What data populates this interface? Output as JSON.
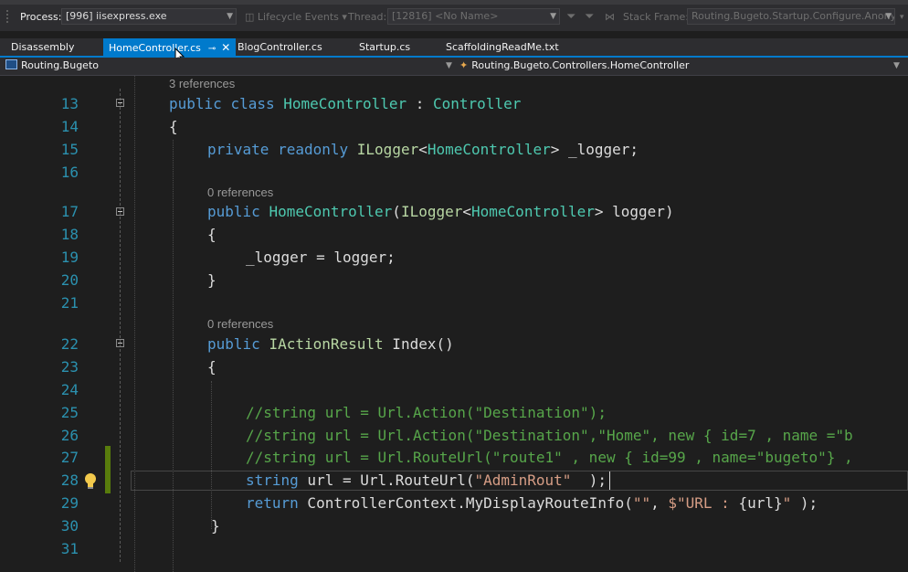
{
  "toolbar": {
    "process_label": "Process:",
    "process_value": "[996] iisexpress.exe",
    "lifecycle_label": "Lifecycle Events",
    "thread_label": "Thread:",
    "thread_value": "[12816] <No Name>",
    "stack_frame_label": "Stack Frame:",
    "stack_frame_value": "Routing.Bugeto.Startup.Configure.Anonyi"
  },
  "tabs": [
    {
      "label": "Disassembly",
      "active": false
    },
    {
      "label": "HomeController.cs",
      "active": true
    },
    {
      "label": "BlogController.cs",
      "active": false
    },
    {
      "label": "Startup.cs",
      "active": false
    },
    {
      "label": "ScaffoldingReadMe.txt",
      "active": false
    }
  ],
  "navbar": {
    "project": "Routing.Bugeto",
    "type": "Routing.Bugeto.Controllers.HomeController"
  },
  "code": {
    "lens_class": "3 references",
    "lens_ctor": "0 references",
    "lens_index": "0 references",
    "lines": [
      {
        "num": "13",
        "tokens": [
          [
            "kw",
            "public"
          ],
          [
            "pl",
            " "
          ],
          [
            "kw",
            "class"
          ],
          [
            "pl",
            " "
          ],
          [
            "ty",
            "HomeController"
          ],
          [
            "pl",
            " : "
          ],
          [
            "ty",
            "Controller"
          ]
        ]
      },
      {
        "num": "14",
        "tokens": [
          [
            "pl",
            "{"
          ]
        ]
      },
      {
        "num": "15",
        "tokens": [
          [
            "kw",
            "private"
          ],
          [
            "pl",
            " "
          ],
          [
            "kw",
            "readonly"
          ],
          [
            "pl",
            " "
          ],
          [
            "in",
            "ILogger"
          ],
          [
            "pl",
            "<"
          ],
          [
            "ty",
            "HomeController"
          ],
          [
            "pl",
            "> _logger;"
          ]
        ]
      },
      {
        "num": "16",
        "tokens": []
      },
      {
        "num": "17",
        "tokens": [
          [
            "kw",
            "public"
          ],
          [
            "pl",
            " "
          ],
          [
            "ty",
            "HomeController"
          ],
          [
            "pl",
            "("
          ],
          [
            "in",
            "ILogger"
          ],
          [
            "pl",
            "<"
          ],
          [
            "ty",
            "HomeController"
          ],
          [
            "pl",
            "> logger)"
          ]
        ]
      },
      {
        "num": "18",
        "tokens": [
          [
            "pl",
            "{"
          ]
        ]
      },
      {
        "num": "19",
        "tokens": [
          [
            "pl",
            "_logger = logger;"
          ]
        ]
      },
      {
        "num": "20",
        "tokens": [
          [
            "pl",
            "}"
          ]
        ]
      },
      {
        "num": "21",
        "tokens": []
      },
      {
        "num": "22",
        "tokens": [
          [
            "kw",
            "public"
          ],
          [
            "pl",
            " "
          ],
          [
            "in",
            "IActionResult"
          ],
          [
            "pl",
            " Index()"
          ]
        ]
      },
      {
        "num": "23",
        "tokens": [
          [
            "pl",
            "{"
          ]
        ]
      },
      {
        "num": "24",
        "tokens": []
      },
      {
        "num": "25",
        "tokens": [
          [
            "cm",
            "//string url = Url.Action(\"Destination\");"
          ]
        ]
      },
      {
        "num": "26",
        "tokens": [
          [
            "cm",
            "//string url = Url.Action(\"Destination\",\"Home\", new { id=7 , name =\"b"
          ]
        ]
      },
      {
        "num": "27",
        "tokens": [
          [
            "cm",
            "//string url = Url.RouteUrl(\"route1\" , new { id=99 , name=\"bugeto\"} ,"
          ]
        ]
      },
      {
        "num": "28",
        "tokens": [
          [
            "kw",
            "string"
          ],
          [
            "pl",
            " url = Url.RouteUrl("
          ],
          [
            "st",
            "\"AdminRout\""
          ],
          [
            "pl",
            " "
          ],
          [
            "pl",
            " );"
          ]
        ]
      },
      {
        "num": "29",
        "tokens": [
          [
            "kw",
            "return"
          ],
          [
            "pl",
            " ControllerContext.MyDisplayRouteInfo("
          ],
          [
            "st",
            "\"\""
          ],
          [
            "pl",
            ", "
          ],
          [
            "st",
            "$\"URL : "
          ],
          [
            "pl",
            "{url}"
          ],
          [
            "st",
            "\""
          ],
          [
            "pl",
            " );"
          ]
        ]
      },
      {
        "num": "30",
        "tokens": [
          [
            "pl",
            "}"
          ]
        ]
      },
      {
        "num": "31",
        "tokens": []
      }
    ]
  }
}
